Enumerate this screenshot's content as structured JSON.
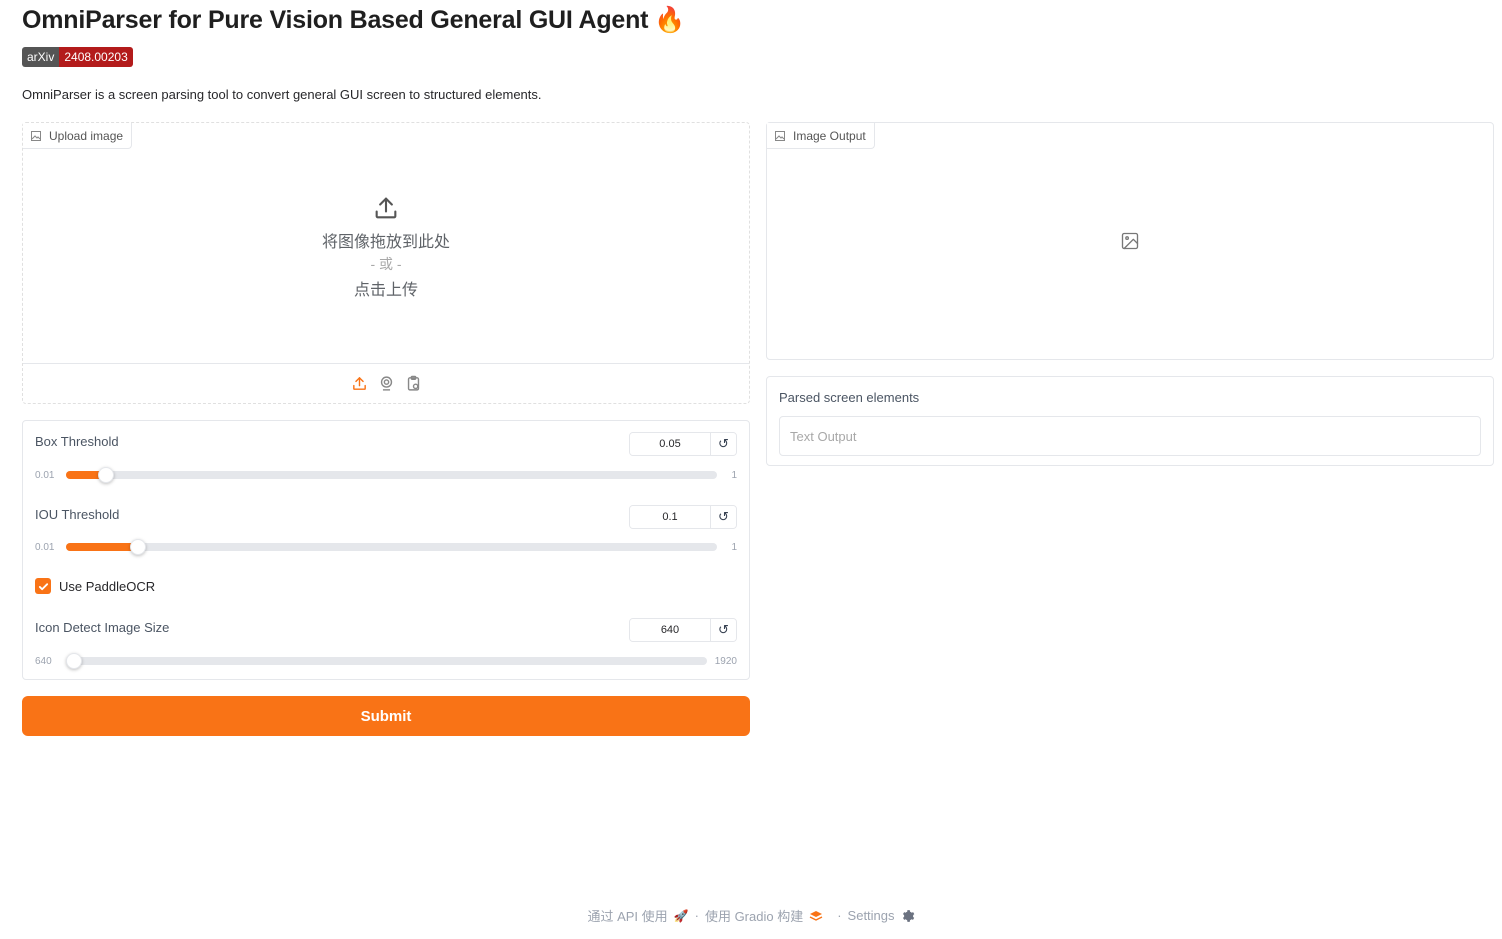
{
  "header": {
    "title": "OmniParser for Pure Vision Based General GUI Agent",
    "title_emoji": "🔥",
    "badge_left": "arXiv",
    "badge_right": "2408.00203",
    "description": "OmniParser is a screen parsing tool to convert general GUI screen to structured elements."
  },
  "upload": {
    "label": "Upload image",
    "drop_text": "将图像拖放到此处",
    "or_text": "- 或 -",
    "click_text": "点击上传"
  },
  "controls": {
    "box_threshold": {
      "label": "Box Threshold",
      "value": "0.05",
      "min": "0.01",
      "max": "1",
      "fraction": 0.05
    },
    "iou_threshold": {
      "label": "IOU Threshold",
      "value": "0.1",
      "min": "0.01",
      "max": "1",
      "fraction": 0.1
    },
    "use_paddleocr": {
      "label": "Use PaddleOCR",
      "checked": true
    },
    "icon_size": {
      "label": "Icon Detect Image Size",
      "value": "640",
      "min": "640",
      "max": "1920",
      "fraction": 0.0
    },
    "reset_symbol": "↺"
  },
  "submit_label": "Submit",
  "output": {
    "image_label": "Image Output",
    "text_label": "Parsed screen elements",
    "text_placeholder": "Text Output"
  },
  "footer": {
    "api": "通过 API 使用",
    "built": "使用 Gradio 构建",
    "settings": "Settings",
    "separator": "·"
  },
  "colors": {
    "accent": "#f97316",
    "badge_right": "#b31b1b"
  }
}
